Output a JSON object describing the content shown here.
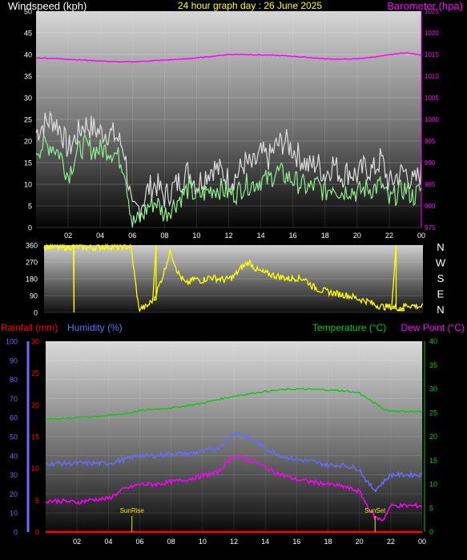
{
  "titles": {
    "wind_axis": "Windspeed (kph)",
    "main": "24 hour graph day : 26 June 2025",
    "baro_axis": "Barometer (hpa)",
    "rain_axis": "Rainfall (mm)",
    "hum_axis": "Humidity (%)",
    "temp_axis": "Temperature (°C)",
    "dew_axis": "Dew Point (°C)",
    "sunrise": "SunRise",
    "sunset": "SunSet"
  },
  "colors": {
    "title": "#ffff00",
    "wind_label": "#ffffff",
    "baro": "#ff00ff",
    "rain": "#ff0000",
    "humidity": "#6a6aff",
    "temperature": "#00cc00",
    "dewpoint": "#ff00ff",
    "direction": "#ffff00",
    "wind_gust": "#dcdcdc",
    "wind_avg": "#90ee90"
  },
  "x_ticks": [
    "02",
    "04",
    "06",
    "08",
    "10",
    "12",
    "14",
    "16",
    "18",
    "20",
    "22",
    "00"
  ],
  "compass_labels": [
    "N",
    "W",
    "S",
    "E",
    "N"
  ],
  "chart_data": [
    {
      "type": "line",
      "title": "24 hour graph day : 26 June 2025",
      "xlabel": "",
      "x_range_hours": [
        0,
        24
      ],
      "ylabel_left": "Windspeed (kph)",
      "ylim_left": [
        0,
        50
      ],
      "yticks_left": [
        0,
        5,
        10,
        15,
        20,
        25,
        30,
        35,
        40,
        45,
        50
      ],
      "ylabel_right": "Barometer (hpa)",
      "ylim_right": [
        975,
        1025
      ],
      "yticks_right": [
        975,
        980,
        985,
        990,
        995,
        1000,
        1005,
        1010,
        1015,
        1020,
        1025
      ],
      "series": [
        {
          "name": "Barometer (hpa)",
          "axis": "right",
          "x": [
            0,
            1,
            2,
            3,
            4,
            5,
            6,
            7,
            8,
            9,
            10,
            11,
            12,
            13,
            14,
            15,
            16,
            17,
            18,
            19,
            20,
            21,
            22,
            23,
            24
          ],
          "values": [
            1014.2,
            1014.1,
            1013.9,
            1013.7,
            1013.5,
            1013.3,
            1013.3,
            1013.5,
            1013.7,
            1013.9,
            1014.2,
            1014.6,
            1015.0,
            1015.0,
            1014.9,
            1014.8,
            1014.6,
            1014.3,
            1014.0,
            1013.9,
            1014.0,
            1014.4,
            1014.9,
            1015.4,
            1014.9
          ]
        },
        {
          "name": "Wind gust",
          "axis": "left",
          "x": [
            0,
            0.5,
            1,
            1.5,
            2,
            2.5,
            3,
            3.5,
            4,
            4.5,
            5,
            5.5,
            6,
            6.5,
            7,
            7.5,
            8,
            8.5,
            9,
            9.5,
            10,
            10.5,
            11,
            11.5,
            12,
            12.5,
            13,
            13.5,
            14,
            14.5,
            15,
            15.5,
            16,
            16.5,
            17,
            17.5,
            18,
            18.5,
            19,
            19.5,
            20,
            20.5,
            21,
            21.5,
            22,
            22.5,
            23,
            23.5,
            24
          ],
          "values": [
            22,
            24,
            25,
            23,
            18,
            21,
            24,
            23,
            22,
            22,
            21,
            18,
            3,
            5,
            9,
            10,
            7,
            9,
            11,
            13,
            10,
            12,
            14,
            13,
            11,
            12,
            15,
            14,
            17,
            16,
            19,
            20,
            18,
            16,
            14,
            15,
            12,
            15,
            12,
            13,
            12,
            14,
            13,
            16,
            10,
            12,
            13,
            10,
            13
          ]
        },
        {
          "name": "Wind average",
          "axis": "left",
          "x": [
            0,
            0.5,
            1,
            1.5,
            2,
            2.5,
            3,
            3.5,
            4,
            4.5,
            5,
            5.5,
            6,
            6.5,
            7,
            7.5,
            8,
            8.5,
            9,
            9.5,
            10,
            10.5,
            11,
            11.5,
            12,
            12.5,
            13,
            13.5,
            14,
            14.5,
            15,
            15.5,
            16,
            16.5,
            17,
            17.5,
            18,
            18.5,
            19,
            19.5,
            20,
            20.5,
            21,
            21.5,
            22,
            22.5,
            23,
            23.5,
            24
          ],
          "values": [
            18,
            19,
            19,
            17,
            12,
            17,
            19,
            18,
            18,
            18,
            17,
            14,
            1,
            2,
            5,
            6,
            3,
            5,
            7,
            9,
            7,
            8,
            9,
            9,
            8,
            8,
            10,
            10,
            11,
            11,
            13,
            12,
            11,
            10,
            9,
            10,
            8,
            10,
            8,
            9,
            8,
            9,
            9,
            10,
            6,
            8,
            9,
            7,
            9
          ]
        }
      ]
    },
    {
      "type": "scatter",
      "title": "",
      "xlabel": "",
      "ylabel": "",
      "x_range_hours": [
        0,
        24
      ],
      "ylim": [
        0,
        360
      ],
      "yticks": [
        0,
        90,
        180,
        270,
        360
      ],
      "series": [
        {
          "name": "Wind direction",
          "x": [
            0,
            0.5,
            1,
            1.5,
            2,
            2.5,
            3,
            3.5,
            4,
            4.5,
            5,
            5.5,
            6,
            6.5,
            7,
            7.5,
            8,
            8.5,
            9,
            9.5,
            10,
            10.5,
            11,
            11.5,
            12,
            12.5,
            13,
            13.5,
            14,
            14.5,
            15,
            15.5,
            16,
            16.5,
            17,
            17.5,
            18,
            18.5,
            19,
            19.5,
            20,
            20.5,
            21,
            21.5,
            22,
            22.5,
            23,
            23.5,
            24
          ],
          "values": [
            350,
            355,
            345,
            350,
            355,
            350,
            345,
            350,
            355,
            350,
            350,
            355,
            20,
            30,
            80,
            190,
            330,
            210,
            150,
            180,
            170,
            190,
            180,
            175,
            190,
            240,
            270,
            225,
            210,
            200,
            190,
            180,
            185,
            180,
            140,
            120,
            110,
            100,
            95,
            85,
            70,
            60,
            40,
            30,
            30,
            25,
            40,
            35,
            30
          ]
        }
      ]
    },
    {
      "type": "line",
      "title": "",
      "xlabel": "",
      "x_range_hours": [
        0,
        24
      ],
      "ylabel_left_outer": "Humidity (%)",
      "ylim_left_outer": [
        0,
        100
      ],
      "yticks_left_outer": [
        0,
        10,
        20,
        30,
        40,
        50,
        60,
        70,
        80,
        90,
        100
      ],
      "ylabel_left_inner": "Rainfall (mm)",
      "ylim_left_inner": [
        0,
        30
      ],
      "yticks_left_inner": [
        0,
        5,
        10,
        15,
        20,
        25,
        30
      ],
      "ylabel_right": "Temperature (°C)",
      "ylabel_right_2": "Dew Point (°C)",
      "ylim_right": [
        0,
        40
      ],
      "yticks_right": [
        0,
        5,
        10,
        15,
        20,
        25,
        30,
        35,
        40
      ],
      "series": [
        {
          "name": "Temperature (°C)",
          "axis": "right",
          "x": [
            0,
            1,
            2,
            3,
            4,
            5,
            6,
            7,
            8,
            9,
            10,
            11,
            12,
            13,
            14,
            15,
            16,
            17,
            18,
            19,
            20,
            20.5,
            21,
            21.5,
            22,
            23,
            24
          ],
          "values": [
            23.7,
            23.8,
            24.0,
            24.2,
            24.4,
            24.8,
            25.4,
            25.8,
            26.0,
            26.5,
            27.0,
            27.8,
            28.5,
            29.0,
            29.5,
            29.8,
            30.0,
            29.9,
            29.8,
            29.6,
            29.2,
            28.0,
            27.0,
            25.8,
            25.4,
            25.3,
            25.2
          ]
        },
        {
          "name": "Humidity (%)",
          "axis": "left_outer",
          "x": [
            0,
            1,
            2,
            3,
            4,
            5,
            6,
            7,
            8,
            9,
            10,
            11,
            11.5,
            12,
            12.5,
            13,
            13.5,
            14,
            15,
            16,
            17,
            18,
            19,
            20,
            20.5,
            21,
            21.5,
            22,
            23,
            24
          ],
          "values": [
            36,
            36,
            36,
            36,
            36,
            38,
            40,
            40,
            41,
            41,
            42,
            44,
            48,
            52,
            51,
            49,
            47,
            44,
            40,
            38,
            37,
            35,
            35,
            33,
            26,
            22,
            26,
            30,
            30,
            30
          ]
        },
        {
          "name": "Dew Point (°C)",
          "axis": "right",
          "x": [
            0,
            1,
            2,
            3,
            4,
            5,
            6,
            7,
            8,
            9,
            10,
            11,
            11.5,
            12,
            12.5,
            13,
            13.5,
            14,
            15,
            16,
            17,
            18,
            19,
            20,
            20.5,
            21,
            21.5,
            22,
            23,
            24
          ],
          "values": [
            6.5,
            6.5,
            6.2,
            6.8,
            7.0,
            9.0,
            10.0,
            10.0,
            10.5,
            11.0,
            11.8,
            12.5,
            14.5,
            16.0,
            15.5,
            15.0,
            14.5,
            13.5,
            12.0,
            11.0,
            10.5,
            10.0,
            9.5,
            8.5,
            5.5,
            3.0,
            2.5,
            5.5,
            5.5,
            5.5
          ]
        },
        {
          "name": "Rainfall (mm)",
          "axis": "left_inner",
          "x": [
            0,
            24
          ],
          "values": [
            0,
            0
          ]
        }
      ],
      "annotations": [
        {
          "text": "SunRise",
          "x": 5.5
        },
        {
          "text": "SunSet",
          "x": 21.0
        }
      ]
    }
  ]
}
